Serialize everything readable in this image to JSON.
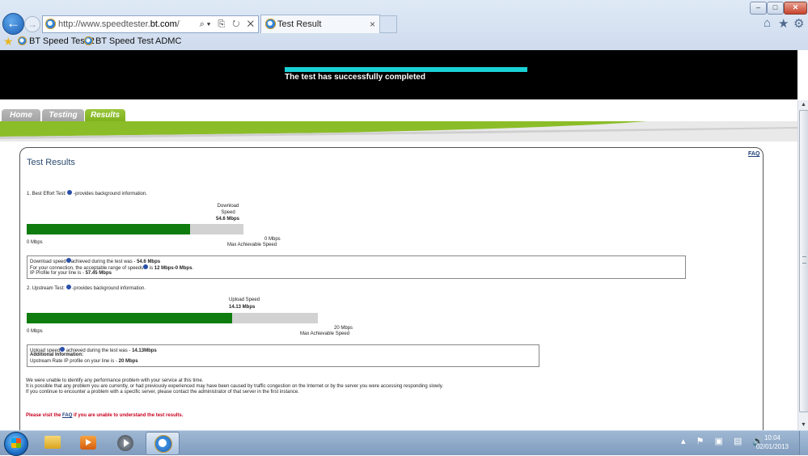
{
  "browser": {
    "url_prefix": "http://www.speedtester.",
    "url_domain": "bt.com",
    "url_suffix": "/",
    "tab_title": "Test Result",
    "tab_close": "×",
    "favorites": [
      "BT Speed Test 2",
      "BT Speed Test",
      "ADMC"
    ],
    "window_buttons": {
      "minimize": "–",
      "maximize": "□",
      "close": "✕"
    },
    "tools": {
      "home": "⌂",
      "favorites": "★",
      "settings": "⚙"
    },
    "address_tools": "⌕▾ ⎘ ↻ ✕"
  },
  "page": {
    "status_text": "The test has successfully completed",
    "progress": 1.0,
    "nav_tabs": [
      {
        "label": "Home",
        "active": false
      },
      {
        "label": "Testing",
        "active": false
      },
      {
        "label": "Results",
        "active": true
      }
    ],
    "faq": "FAQ",
    "title": "Test Results",
    "best_effort": {
      "heading_prefix": "1. Best Effort Test:",
      "heading_suffix": "-provides background information.",
      "speed_label_1": "Download",
      "speed_label_2": "Speed",
      "speed_value": "54.6 Mbps",
      "bar_fill_fraction": 0.755,
      "min_label": "0 Mbps",
      "max_value": "0 Mbps",
      "max_label": "Max Achievable Speed",
      "box_line1_a": "Download speed",
      "box_line1_b": "achieved during the test was - ",
      "box_line1_c": "54.6 Mbps",
      "box_line2_a": "For your connection, the acceptable range of speeds",
      "box_line2_b": " is ",
      "box_line2_c": "12 Mbps-0 Mbps",
      "box_line2_d": ".",
      "box_line3_a": "IP Profile for your line is - ",
      "box_line3_b": "57.45 Mbps"
    },
    "upstream": {
      "heading_prefix": "2. Upstream Test:",
      "heading_suffix": "-provides background information.",
      "speed_label": "Upload Speed",
      "speed_value": "14.13 Mbps",
      "bar_fill_fraction": 0.7065,
      "min_label": "0 Mbps",
      "max_value": "20 Mbps",
      "max_label": "Max Achievable Speed",
      "box_line1_a": "Upload speed",
      "box_line1_b": " achieved during the test was - ",
      "box_line1_c": "14.13Mbps",
      "box_line2": "Additional Information:",
      "box_line3_a": "Upstream Rate IP profile on your line is - ",
      "box_line3_b": "20 Mbps"
    },
    "notes": [
      "We were unable to identify any performance problem with your service at this time.",
      "It is possible that any problem you are currently, or had previously experienced may have been caused by traffic congestion on the Internet or by the server you were accessing responding slowly.",
      "If you continue to encounter a problem with a specific server, please contact the administrator of that server in the first instance."
    ],
    "red_note_prefix": "Please visit the ",
    "red_note_link": "FAQ",
    "red_note_suffix": " if you are unable to understand the test results."
  },
  "colors": {
    "bar_fill": "#0e7c0e",
    "bar_track": "#d2d2d2",
    "nav_active": "#8bbd28",
    "progress": "#19d1d6",
    "banner": "#000000"
  },
  "taskbar": {
    "apps": [
      "windows-explorer",
      "media-center",
      "windows-media-player",
      "internet-explorer"
    ],
    "tray_icons": "▴ ⚑ ▣ ▤ 🔊",
    "time": "10:04",
    "date": "02/01/2013"
  }
}
